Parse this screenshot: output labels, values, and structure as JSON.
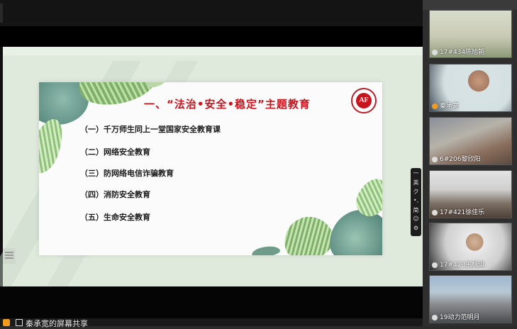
{
  "presentation": {
    "title": "一、“法治•安全•稳定”主题教育",
    "items": [
      "（一）千万师生同上一堂国家安全教育课",
      "（二）网络安全教育",
      "（三）防网络电信诈骗教育",
      "（四）消防安全教育",
      "（五）生命安全教育"
    ],
    "logo_text": "AF"
  },
  "status": {
    "share_text": "秦承宽的屏幕共享"
  },
  "participants": [
    {
      "name": "17#434陈旭朝"
    },
    {
      "name": "秦承宽"
    },
    {
      "name": "6#206黎欣阳"
    },
    {
      "name": "17#421徐佳乐"
    },
    {
      "name": "17#423王枫淇"
    },
    {
      "name": "19动力范明月"
    }
  ],
  "ime": {
    "items": [
      "一",
      "英",
      "ク",
      "•,",
      "简",
      "☺",
      "⚙"
    ]
  },
  "colors": {
    "title_red": "#c8141e",
    "slide_bg": "#fbfbfb",
    "frame_green": "#dfe9dc",
    "share_icon": "#f29b1c"
  }
}
